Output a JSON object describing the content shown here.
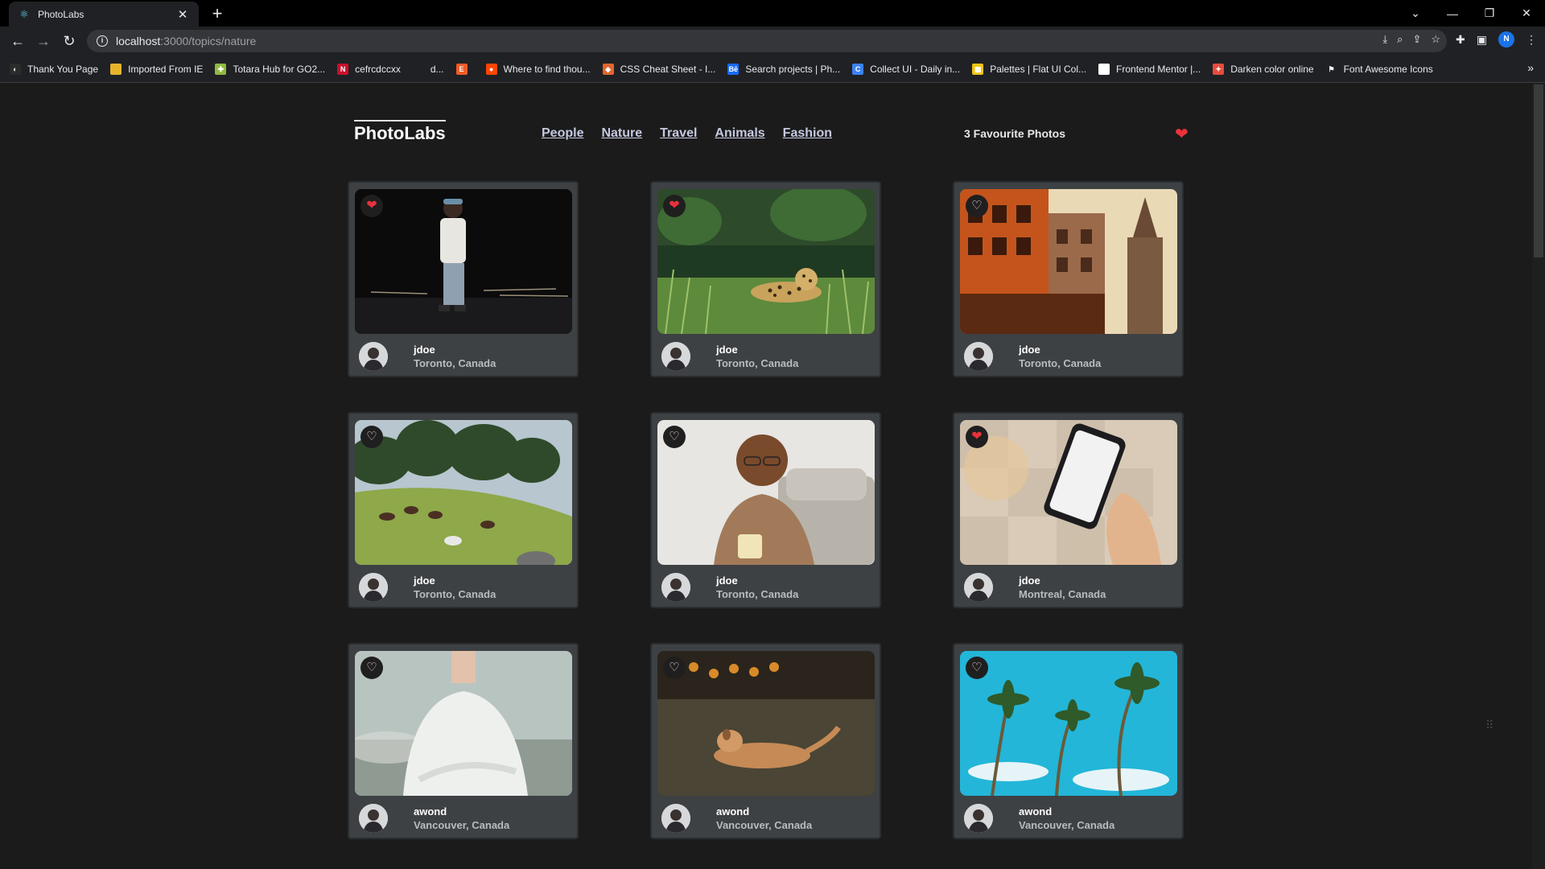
{
  "browser": {
    "tab_title": "PhotoLabs",
    "url_host": "localhost",
    "url_path": ":3000/topics/nature",
    "profile_initial": "N",
    "bookmarks": [
      {
        "label": "Thank You Page",
        "color": "#2b2b2b",
        "glyph": "◐"
      },
      {
        "label": "Imported From IE",
        "color": "#e6b32c",
        "glyph": ""
      },
      {
        "label": "Totara Hub for GO2...",
        "color": "#8fb93f",
        "glyph": "✚"
      },
      {
        "label": "cefrcdccxx",
        "color": "#c8102e",
        "glyph": "N"
      },
      {
        "label": "d...",
        "color": "#202124",
        "glyph": ""
      },
      {
        "label": "",
        "color": "#f05a28",
        "glyph": "E"
      },
      {
        "label": "Where to find thou...",
        "color": "#ff4500",
        "glyph": "●"
      },
      {
        "label": "CSS Cheat Sheet - I...",
        "color": "#e2662b",
        "glyph": "◆"
      },
      {
        "label": "Search projects | Ph...",
        "color": "#1769ff",
        "glyph": "Bē"
      },
      {
        "label": "Collect UI - Daily in...",
        "color": "#3b82f6",
        "glyph": "C"
      },
      {
        "label": "Palettes | Flat UI Col...",
        "color": "#f1c40f",
        "glyph": "▦"
      },
      {
        "label": "Frontend Mentor |...",
        "color": "#ffffff",
        "glyph": ""
      },
      {
        "label": "Darken color online",
        "color": "#e74c3c",
        "glyph": "✦"
      },
      {
        "label": "Font Awesome Icons",
        "color": "#202124",
        "glyph": "⚑"
      }
    ]
  },
  "app": {
    "logo": "PhotoLabs",
    "topics": [
      "People",
      "Nature",
      "Travel",
      "Animals",
      "Fashion"
    ],
    "fav_count_text": "3 Favourite Photos"
  },
  "photos": [
    {
      "user": "jdoe",
      "location": "Toronto, Canada",
      "liked": true,
      "scene": "night-man"
    },
    {
      "user": "jdoe",
      "location": "Toronto, Canada",
      "liked": true,
      "scene": "leopard"
    },
    {
      "user": "jdoe",
      "location": "Toronto, Canada",
      "liked": false,
      "scene": "city-buildings"
    },
    {
      "user": "jdoe",
      "location": "Toronto, Canada",
      "liked": false,
      "scene": "horses-hill"
    },
    {
      "user": "jdoe",
      "location": "Toronto, Canada",
      "liked": false,
      "scene": "smiling-man"
    },
    {
      "user": "jdoe",
      "location": "Montreal, Canada",
      "liked": true,
      "scene": "phone-hand"
    },
    {
      "user": "awond",
      "location": "Vancouver, Canada",
      "liked": false,
      "scene": "woman-white"
    },
    {
      "user": "awond",
      "location": "Vancouver, Canada",
      "liked": false,
      "scene": "dog-lying"
    },
    {
      "user": "awond",
      "location": "Vancouver, Canada",
      "liked": false,
      "scene": "palm-trees"
    }
  ]
}
